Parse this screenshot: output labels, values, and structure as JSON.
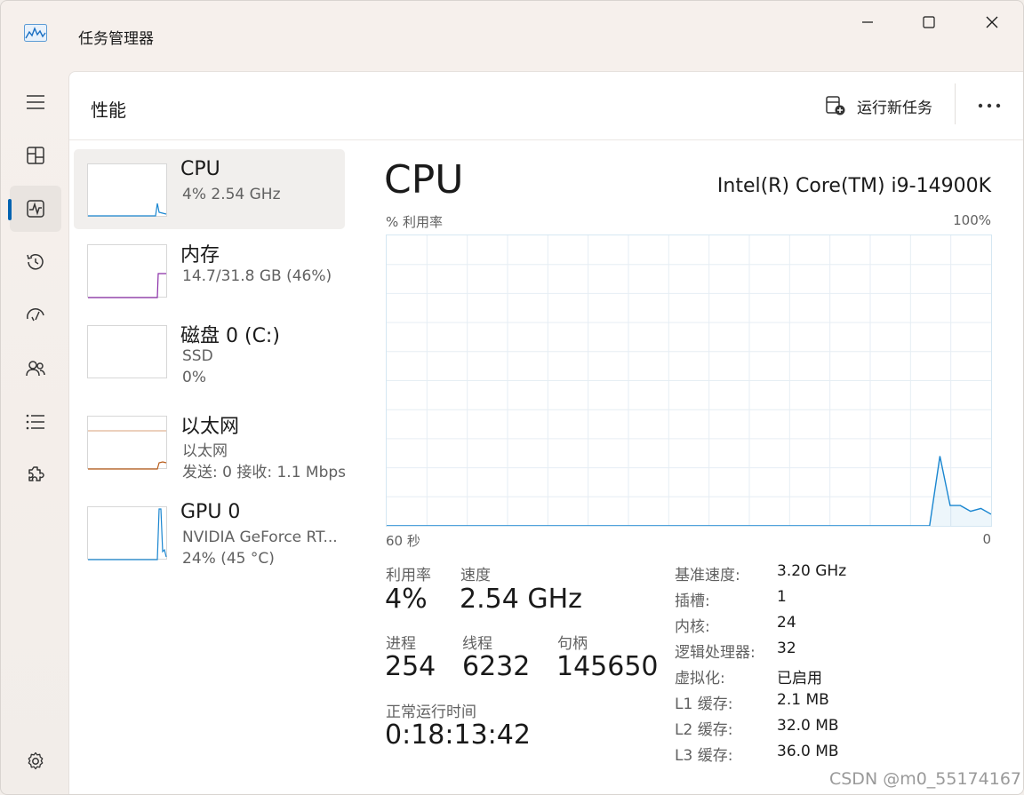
{
  "window": {
    "title": "任务管理器"
  },
  "header": {
    "page_title": "性能",
    "run_task_label": "运行新任务"
  },
  "nav": {
    "items": [
      {
        "icon": "hamburger-menu-icon"
      },
      {
        "icon": "processes-icon"
      },
      {
        "icon": "performance-icon",
        "active": true
      },
      {
        "icon": "app-history-icon"
      },
      {
        "icon": "startup-apps-icon"
      },
      {
        "icon": "users-icon"
      },
      {
        "icon": "details-icon"
      },
      {
        "icon": "services-icon"
      },
      {
        "icon": "settings-icon"
      }
    ]
  },
  "devices": [
    {
      "name": "CPU",
      "line1": "4%  2.54 GHz",
      "line2": "",
      "color": "#1a86d0",
      "selected": true
    },
    {
      "name": "内存",
      "line1": "14.7/31.8 GB (46%)",
      "line2": "",
      "color": "#8b2fa8",
      "selected": false
    },
    {
      "name": "磁盘 0 (C:)",
      "line1": "SSD",
      "line2": "0%",
      "color": "#4c9a2a",
      "selected": false
    },
    {
      "name": "以太网",
      "line1": "以太网",
      "line2": "发送: 0 接收: 1.1 Mbps",
      "color": "#b85c1a",
      "selected": false
    },
    {
      "name": "GPU 0",
      "line1": "NVIDIA GeForce RT...",
      "line2": "24% (45 °C)",
      "color": "#1a86d0",
      "selected": false
    }
  ],
  "detail": {
    "title": "CPU",
    "model": "Intel(R) Core(TM) i9-14900K",
    "graph": {
      "y_label": "% 利用率",
      "y_max_label": "100%",
      "x_left_label": "60 秒",
      "x_right_label": "0",
      "line_color": "#1a86d0"
    },
    "stats": {
      "utilization_label": "利用率",
      "utilization_value": "4%",
      "speed_label": "速度",
      "speed_value": "2.54 GHz",
      "processes_label": "进程",
      "processes_value": "254",
      "threads_label": "线程",
      "threads_value": "6232",
      "handles_label": "句柄",
      "handles_value": "145650",
      "uptime_label": "正常运行时间",
      "uptime_value": "0:18:13:42"
    },
    "specs": [
      {
        "label": "基准速度:",
        "value": "3.20 GHz"
      },
      {
        "label": "插槽:",
        "value": "1"
      },
      {
        "label": "内核:",
        "value": "24"
      },
      {
        "label": "逻辑处理器:",
        "value": "32"
      },
      {
        "label": "虚拟化:",
        "value": "已启用"
      },
      {
        "label": "L1 缓存:",
        "value": "2.1 MB"
      },
      {
        "label": "L2 缓存:",
        "value": "32.0 MB"
      },
      {
        "label": "L3 缓存:",
        "value": "36.0 MB"
      }
    ]
  },
  "chart_data": {
    "type": "line",
    "title": "",
    "xlabel": "",
    "ylabel": "% 利用率",
    "x_range_seconds": [
      60,
      0
    ],
    "ylim": [
      0,
      100
    ],
    "grid": true,
    "series": [
      {
        "values": [
          0,
          0,
          0,
          0,
          0,
          0,
          0,
          0,
          0,
          0,
          0,
          0,
          0,
          0,
          0,
          0,
          0,
          0,
          0,
          0,
          0,
          0,
          0,
          0,
          0,
          0,
          0,
          0,
          0,
          0,
          0,
          0,
          0,
          0,
          0,
          0,
          0,
          0,
          0,
          0,
          0,
          0,
          0,
          0,
          0,
          0,
          0,
          0,
          0,
          0,
          0,
          0,
          0,
          0,
          24,
          7,
          7,
          5,
          6,
          4
        ]
      }
    ]
  },
  "watermark": "CSDN @m0_55174167"
}
